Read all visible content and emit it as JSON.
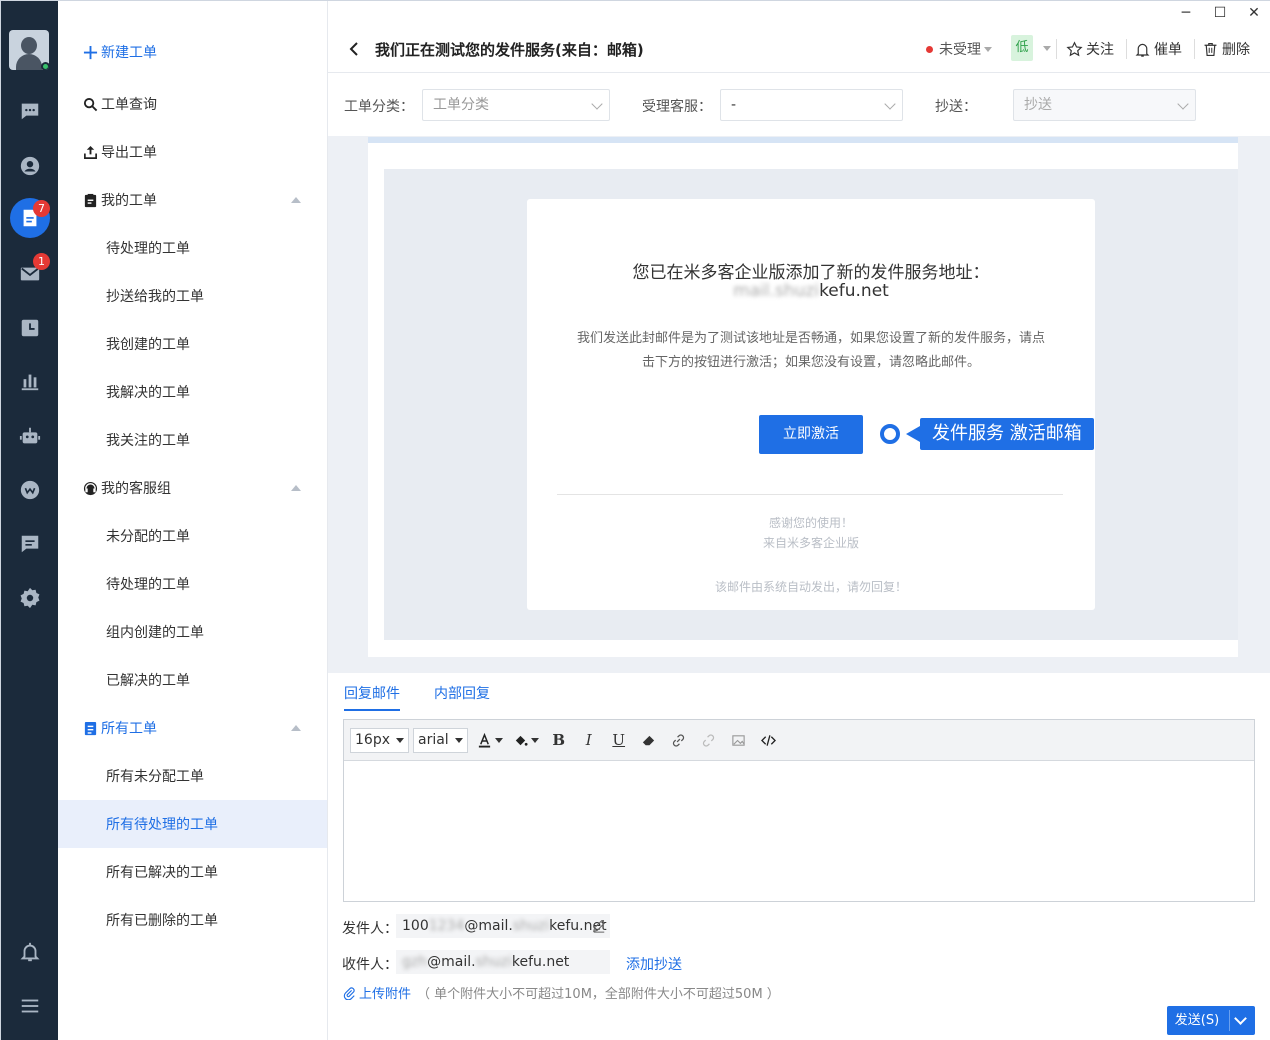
{
  "window": {
    "minimize": "─",
    "maximize": "☐",
    "close": "✕"
  },
  "rail": {
    "badges": {
      "tickets": "7",
      "mail": "1"
    }
  },
  "nav": {
    "new_ticket": "新建工单",
    "query": "工单查询",
    "export": "导出工单",
    "my_tickets": {
      "title": "我的工单",
      "items": [
        "待处理的工单",
        "抄送给我的工单",
        "我创建的工单",
        "我解决的工单",
        "我关注的工单"
      ]
    },
    "my_group": {
      "title": "我的客服组",
      "items": [
        "未分配的工单",
        "待处理的工单",
        "组内创建的工单",
        "已解决的工单"
      ]
    },
    "all_tickets": {
      "title": "所有工单",
      "items": [
        "所有未分配工单",
        "所有待处理的工单",
        "所有已解决的工单",
        "所有已删除的工单"
      ],
      "selected_index": 1
    }
  },
  "header": {
    "title": "我们正在测试您的发件服务(来自：邮箱)",
    "status": "未受理",
    "priority": "低",
    "follow": "关注",
    "remind": "催单",
    "delete": "删除"
  },
  "fields": {
    "category_label": "工单分类：",
    "category_value": "工单分类",
    "agent_label": "受理客服：",
    "agent_value": "-",
    "cc_label": "抄送：",
    "cc_value": "抄送"
  },
  "mail": {
    "heading": "您已在米多客企业版添加了新的发件服务地址：",
    "address_blur": "mail.shuzi",
    "address_visible": "kefu.net",
    "body_line1": "我们发送此封邮件是为了测试该地址是否畅通，如果您设置了新的发件服务，请点",
    "body_line2": "击下方的按钮进行激活；如果您没有设置，请忽略此邮件。",
    "activate_button": "立即激活",
    "thanks": "感谢您的使用！",
    "from": "来自米多客企业版",
    "auto": "该邮件由系统自动发出，请勿回复！"
  },
  "callout": {
    "text": "发件服务  激活邮箱"
  },
  "reply": {
    "tab_reply": "回复邮件",
    "tab_internal": "内部回复",
    "font_size": "16px",
    "font_family": "arial",
    "sender_label": "发件人：",
    "sender_prefix": "100",
    "sender_blur1": "1234",
    "sender_mid": "@mail.",
    "sender_blur2": "shuzi",
    "sender_suffix": "kefu.net",
    "receiver_label": "收件人：",
    "receiver_blur1": "gzh",
    "receiver_mid": "@mail.",
    "receiver_blur2": "shuzi",
    "receiver_suffix": "kefu.net",
    "add_cc": "添加抄送",
    "upload": "上传附件",
    "upload_note": "（ 单个附件大小不可超过10M，全部附件大小不可超过50M ）",
    "send": "发送(S)"
  },
  "colors": {
    "accent": "#1f6fe5",
    "rail": "#1b2a3b",
    "badge": "#e53935",
    "priority_bg": "#d8f3dd"
  }
}
